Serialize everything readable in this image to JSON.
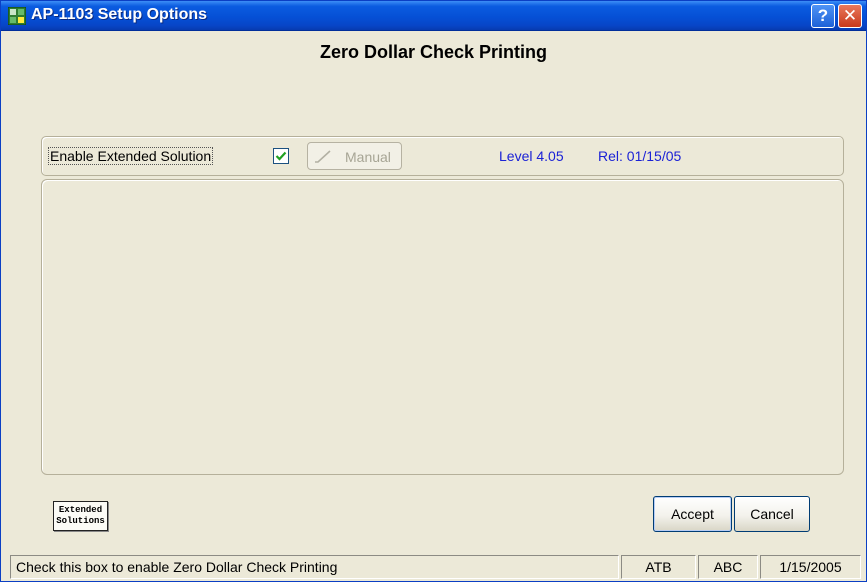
{
  "window": {
    "title": "AP-1103 Setup Options",
    "help_label": "?",
    "close_label": "✕"
  },
  "heading": "Zero Dollar Check Printing",
  "options": {
    "enable_label": "Enable Extended Solution",
    "enable_checked": true,
    "manual_label": "Manual",
    "level": "Level 4.05",
    "release": "Rel: 01/15/05"
  },
  "logo": {
    "line1": "Extended",
    "line2": "Solutions"
  },
  "buttons": {
    "accept_label": "Accept",
    "cancel_label": "Cancel"
  },
  "statusbar": {
    "message": "Check this box to enable Zero Dollar Check Printing",
    "cell1": "ATB",
    "cell2": "ABC",
    "cell3": "1/15/2005"
  },
  "colors": {
    "titlebar": "#0550d6",
    "info_text": "#1b22d6",
    "check_mark": "#21a121"
  }
}
